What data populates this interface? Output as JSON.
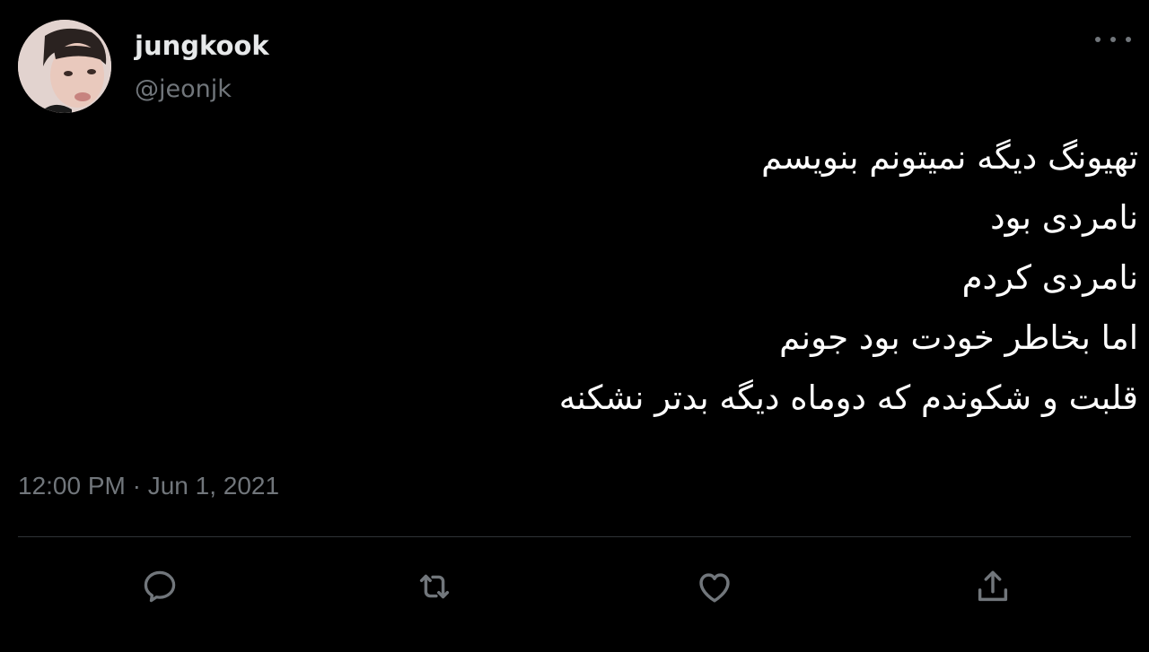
{
  "author": {
    "display_name": "jungkook",
    "handle": "@jeonjk",
    "avatar_icon": "profile-photo"
  },
  "tweet": {
    "lines": [
      "تهیونگ دیگه نمیتونم بنویسم",
      "نامردی بود",
      "نامردی کردم",
      "اما بخاطر خودت بود جونم",
      "قلبت و شکوندم که دوماه دیگه بدتر نشکنه"
    ],
    "timestamp": "12:00 PM · Jun 1, 2021"
  },
  "actions": [
    {
      "name": "reply",
      "icon": "reply-icon"
    },
    {
      "name": "retweet",
      "icon": "retweet-icon"
    },
    {
      "name": "like",
      "icon": "heart-icon"
    },
    {
      "name": "share",
      "icon": "share-icon"
    }
  ],
  "colors": {
    "background": "#000000",
    "primary_text": "#e7e9ea",
    "secondary_text": "#71767b",
    "divider": "#2f3336"
  }
}
